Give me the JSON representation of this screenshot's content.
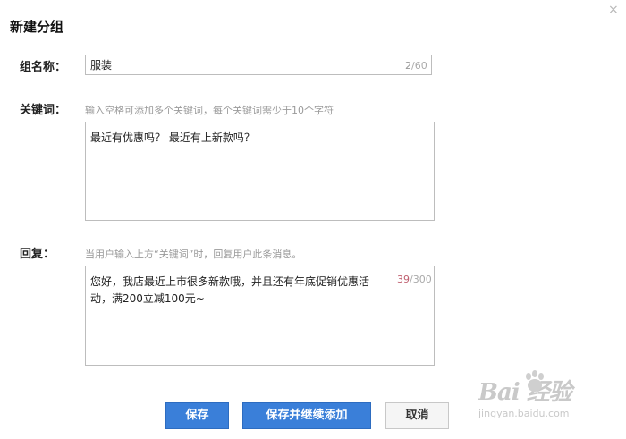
{
  "dialog": {
    "title": "新建分组",
    "close_glyph": "×",
    "close_icon": "close-icon"
  },
  "group_name": {
    "label": "组名称：",
    "value": "服装",
    "count_used": "2",
    "count_max": "/60"
  },
  "keywords": {
    "label": "关键词：",
    "hint": "输入空格可添加多个关键词，每个关键词需少于10个字符",
    "value": "最近有优惠吗？ 最近有上新款吗？"
  },
  "reply": {
    "label": "回复：",
    "hint": "当用户输入上方“关键词”时，回复用户此条消息。",
    "value": "您好，我店最近上市很多新款哦，并且还有年底促销优惠活动，满200立减100元~",
    "count_used": "39",
    "count_max": "/300"
  },
  "buttons": {
    "save": "保存",
    "save_continue": "保存并继续添加",
    "cancel": "取消"
  },
  "watermark": {
    "brand": "Bai 经验",
    "url": "jingyan.baidu.com"
  },
  "colors": {
    "primary": "#3a7fd9",
    "counter_warn": "#c06070"
  }
}
